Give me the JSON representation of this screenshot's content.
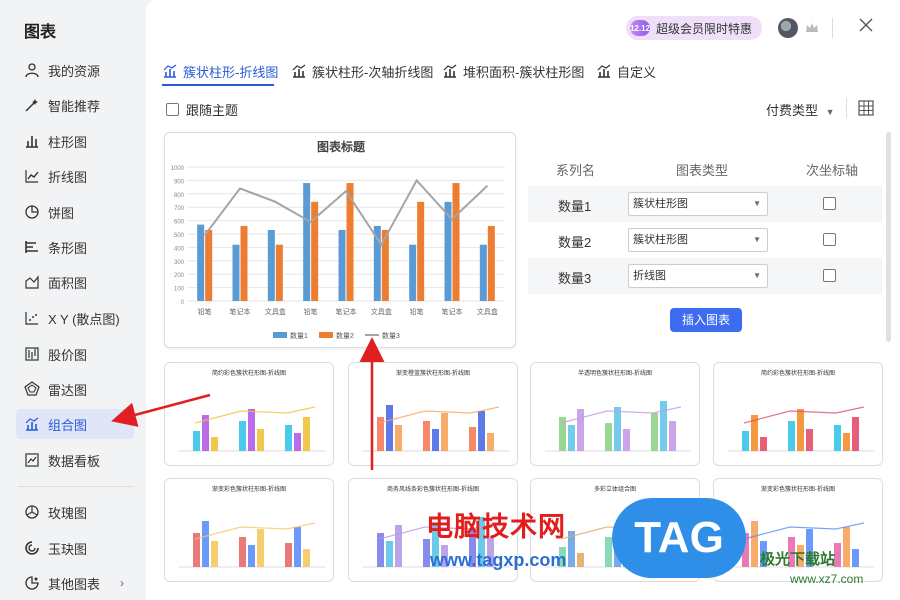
{
  "app_title": "图表",
  "sidebar": {
    "items": [
      {
        "label": "我的资源",
        "icon": "user-icon"
      },
      {
        "label": "智能推荐",
        "icon": "magic-icon"
      },
      {
        "label": "柱形图",
        "icon": "bar-chart-icon"
      },
      {
        "label": "折线图",
        "icon": "line-chart-icon"
      },
      {
        "label": "饼图",
        "icon": "pie-chart-icon"
      },
      {
        "label": "条形图",
        "icon": "hbar-chart-icon"
      },
      {
        "label": "面积图",
        "icon": "area-chart-icon"
      },
      {
        "label": "X Y (散点图)",
        "icon": "scatter-chart-icon"
      },
      {
        "label": "股价图",
        "icon": "stock-chart-icon"
      },
      {
        "label": "雷达图",
        "icon": "radar-chart-icon"
      },
      {
        "label": "组合图",
        "icon": "combo-chart-icon",
        "active": true
      },
      {
        "label": "数据看板",
        "icon": "dashboard-icon"
      },
      {
        "label": "玫瑰图",
        "icon": "rose-chart-icon"
      },
      {
        "label": "玉玦图",
        "icon": "ring-chart-icon"
      },
      {
        "label": "其他图表",
        "icon": "other-chart-icon"
      }
    ]
  },
  "header": {
    "vip_badge": "超级会员限时特惠",
    "vip_icon_text": "12.12"
  },
  "tabs": [
    {
      "label": "簇状柱形-折线图",
      "active": true
    },
    {
      "label": "簇状柱形-次轴折线图"
    },
    {
      "label": "堆积面积-簇状柱形图"
    },
    {
      "label": "自定义"
    }
  ],
  "toolbar": {
    "follow_theme": "跟随主题",
    "pay_type": "付费类型"
  },
  "series_table": {
    "headers": [
      "系列名",
      "图表类型",
      "次坐标轴"
    ],
    "rows": [
      {
        "name": "数量1",
        "type": "簇状柱形图"
      },
      {
        "name": "数量2",
        "type": "簇状柱形图"
      },
      {
        "name": "数量3",
        "type": "折线图"
      }
    ],
    "insert_button": "插入图表"
  },
  "chart_data": {
    "type": "bar",
    "title": "图表标题",
    "categories": [
      "铅笔",
      "笔记本",
      "文具盒",
      "铅笔",
      "笔记本",
      "文具盒",
      "铅笔",
      "笔记本",
      "文具盒"
    ],
    "ylim": [
      0,
      1000
    ],
    "yticks": [
      0,
      100,
      200,
      300,
      400,
      500,
      600,
      700,
      800,
      900,
      1000
    ],
    "series": [
      {
        "name": "数量1",
        "kind": "bar",
        "color": "#5b9bd5",
        "values": [
          570,
          420,
          530,
          880,
          530,
          560,
          420,
          740,
          420
        ]
      },
      {
        "name": "数量2",
        "kind": "bar",
        "color": "#ed7d31",
        "values": [
          530,
          560,
          420,
          740,
          880,
          530,
          740,
          880,
          560
        ]
      },
      {
        "name": "数量3",
        "kind": "line",
        "color": "#a5a5a5",
        "values": [
          490,
          840,
          740,
          590,
          820,
          420,
          900,
          610,
          860
        ]
      }
    ],
    "grid": true,
    "legend": "bottom"
  },
  "templates": [
    {
      "title": "简约彩色簇状柱形图-折线图"
    },
    {
      "title": "渐变橙蓝簇状柱形图-折线图"
    },
    {
      "title": "半透明色簇状柱形图-折线图"
    },
    {
      "title": "简约彩色簇状柱形图-折线图"
    },
    {
      "title": "渐变彩色簇状柱形图-折线图"
    },
    {
      "title": "商务风线条彩色簇状柱形图-折线图"
    },
    {
      "title": "多彩立体组合图"
    },
    {
      "title": "渐变彩色簇状柱形图-折线图"
    }
  ],
  "watermark": {
    "cn": "电脑技术网",
    "url": "www.tagxp.com",
    "tag": "TAG",
    "site": "极光下载站",
    "site_url": "www.xz7.com"
  }
}
